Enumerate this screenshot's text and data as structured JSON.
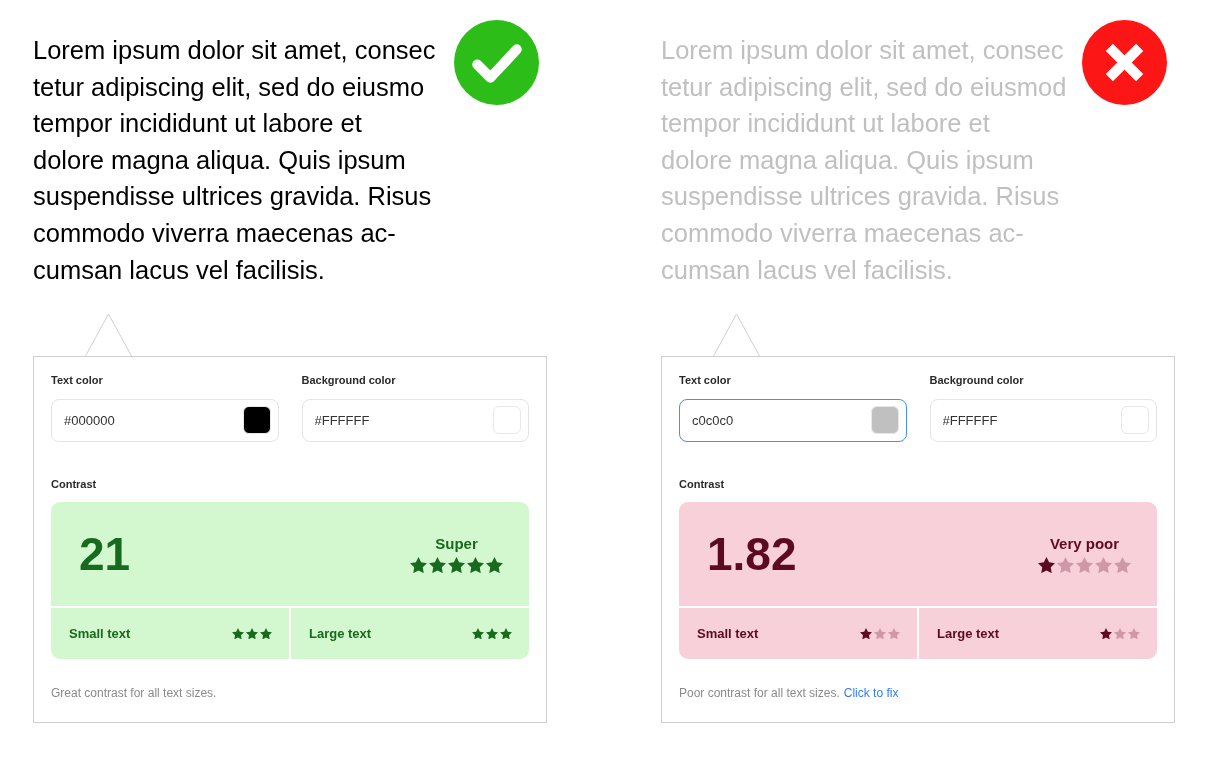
{
  "examples": [
    {
      "kind": "pass",
      "sample_text": [
        "Lorem ipsum dolor sit amet, consec",
        "tetur adipiscing elit, sed do eiusmo",
        "tempor incididunt ut labore et",
        "dolore magna aliqua. Quis ipsum",
        "suspendisse ultrices gravida. Risus",
        "commodo viverra maecenas ac-",
        "cumsan lacus vel facilisis."
      ],
      "fields": [
        {
          "label": "Text color",
          "value": "#000000",
          "color": "#000000",
          "focused": false
        },
        {
          "label": "Background color",
          "value": "#FFFFFF",
          "color": "#ffffff",
          "focused": false
        }
      ],
      "contrast_label": "Contrast",
      "score": "21",
      "rating": {
        "label": "Super",
        "stars": 5
      },
      "checks": [
        {
          "label": "Small text",
          "stars": 3
        },
        {
          "label": "Large text",
          "stars": 3
        }
      ],
      "note": "Great contrast for all text sizes."
    },
    {
      "kind": "fail",
      "sample_text": [
        "Lorem ipsum dolor sit amet, consec",
        "tetur adipiscing elit, sed do eiusmod",
        "tempor incididunt ut labore et",
        "dolore magna aliqua. Quis ipsum",
        "suspendisse ultrices gravida. Risus",
        "commodo viverra maecenas ac-",
        "cumsan lacus vel facilisis."
      ],
      "fields": [
        {
          "label": "Text color",
          "value": "c0c0c0",
          "color": "#c0c0c0",
          "focused": true
        },
        {
          "label": "Background color",
          "value": "#FFFFFF",
          "color": "#ffffff",
          "focused": false
        }
      ],
      "contrast_label": "Contrast",
      "score": "1.82",
      "rating": {
        "label": "Very poor",
        "stars": 1
      },
      "checks": [
        {
          "label": "Small text",
          "stars": 1
        },
        {
          "label": "Large text",
          "stars": 1
        }
      ],
      "note": "Poor contrast for all text sizes.",
      "fix_link": "Click to fix"
    }
  ]
}
